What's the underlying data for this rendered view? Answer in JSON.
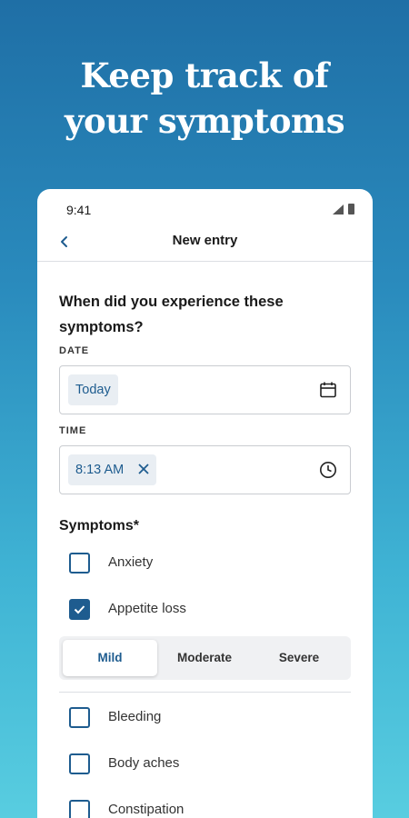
{
  "hero": {
    "line1": "Keep track of",
    "line2": "your symptoms"
  },
  "status": {
    "time": "9:41"
  },
  "appbar": {
    "title": "New entry"
  },
  "form": {
    "question": "When did you experience these symptoms?",
    "date_label": "DATE",
    "date_value": "Today",
    "time_label": "TIME",
    "time_value": "8:13 AM"
  },
  "symptoms": {
    "title": "Symptoms*",
    "items": [
      {
        "label": "Anxiety",
        "checked": false
      },
      {
        "label": "Appetite loss",
        "checked": true
      },
      {
        "label": "Bleeding",
        "checked": false
      },
      {
        "label": "Body aches",
        "checked": false
      },
      {
        "label": "Constipation",
        "checked": false
      }
    ],
    "severity": {
      "options": [
        "Mild",
        "Moderate",
        "Severe"
      ],
      "selected": "Mild"
    }
  },
  "colors": {
    "accent": "#1e5c8f",
    "chip_bg": "#e9eef3"
  }
}
